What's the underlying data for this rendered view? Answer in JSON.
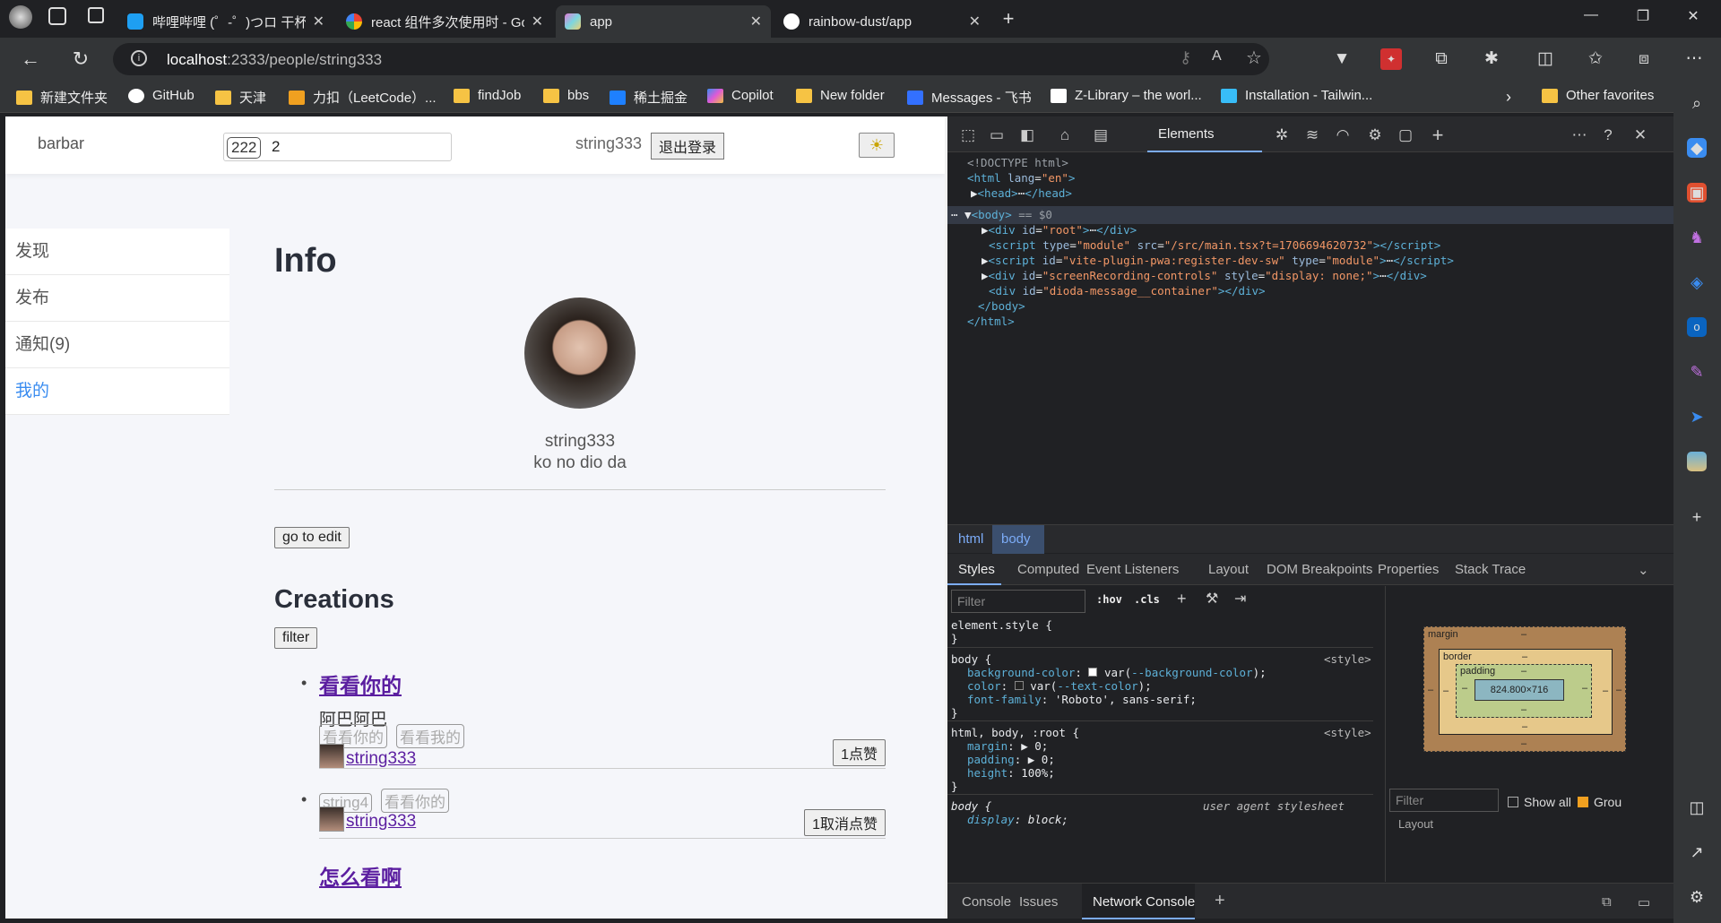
{
  "browser": {
    "tabs": [
      {
        "title": "哔哩哔哩 (゜-゜)つロ 干杯~-bilibili",
        "color": "#1e9ff2"
      },
      {
        "title": "react 组件多次使用时 - Google 搜",
        "color": "#ffffff"
      },
      {
        "title": "app",
        "color": "#e07bd6"
      },
      {
        "title": "rainbow-dust/app",
        "color": "#ffffff"
      }
    ],
    "url_host": "localhost",
    "url_path": ":2333/people/string333",
    "bookmarks": [
      "新建文件夹",
      "GitHub",
      "天津",
      "力扣（LeetCode）...",
      "findJob",
      "bbs",
      "稀土掘金",
      "Copilot",
      "New folder",
      "Messages - 飞书",
      "Z-Library – the worl...",
      "Installation - Tailwin...",
      "Other favorites"
    ]
  },
  "app": {
    "brand": "barbar",
    "badge_count": "222",
    "badge_value": "2",
    "username": "string333",
    "logout_label": "退出登录",
    "theme_icon": "☀",
    "nav": [
      {
        "label": "发现"
      },
      {
        "label": "发布"
      },
      {
        "label": "通知(9)"
      },
      {
        "label": "我的"
      }
    ],
    "info_title": "Info",
    "profile_name": "string333",
    "profile_bio": "ko no dio da",
    "edit_label": "go to edit",
    "creations_title": "Creations",
    "filter_label": "filter",
    "items": [
      {
        "title": "看看你的",
        "desc": "阿巴阿巴",
        "tags": [
          "看看你的",
          "看看我的"
        ],
        "author": "string333",
        "like": "1点赞"
      },
      {
        "title": "",
        "desc": "",
        "tags": [
          "string4",
          "看看你的"
        ],
        "author": "string333",
        "like": "1取消点赞"
      },
      {
        "title": "怎么看啊"
      }
    ]
  },
  "devtools": {
    "elements_tab": "Elements",
    "crumbs": [
      "html",
      "body"
    ],
    "style_tabs": [
      "Styles",
      "Computed",
      "Event Listeners",
      "Layout",
      "DOM Breakpoints",
      "Properties",
      "Stack Trace"
    ],
    "filter_placeholder": "Filter",
    "hov": ":hov",
    "cls": ".cls",
    "box_content": "824.800×716",
    "box_labels": {
      "margin": "margin",
      "border": "border",
      "padding": "padding",
      "dash": "–"
    },
    "show_all": "Show all",
    "group": "Grou",
    "layout_label": "Layout",
    "console_tabs": [
      "Console",
      "Issues",
      "Network Console"
    ],
    "style_source": "<style>",
    "ua_source": "user agent stylesheet"
  }
}
